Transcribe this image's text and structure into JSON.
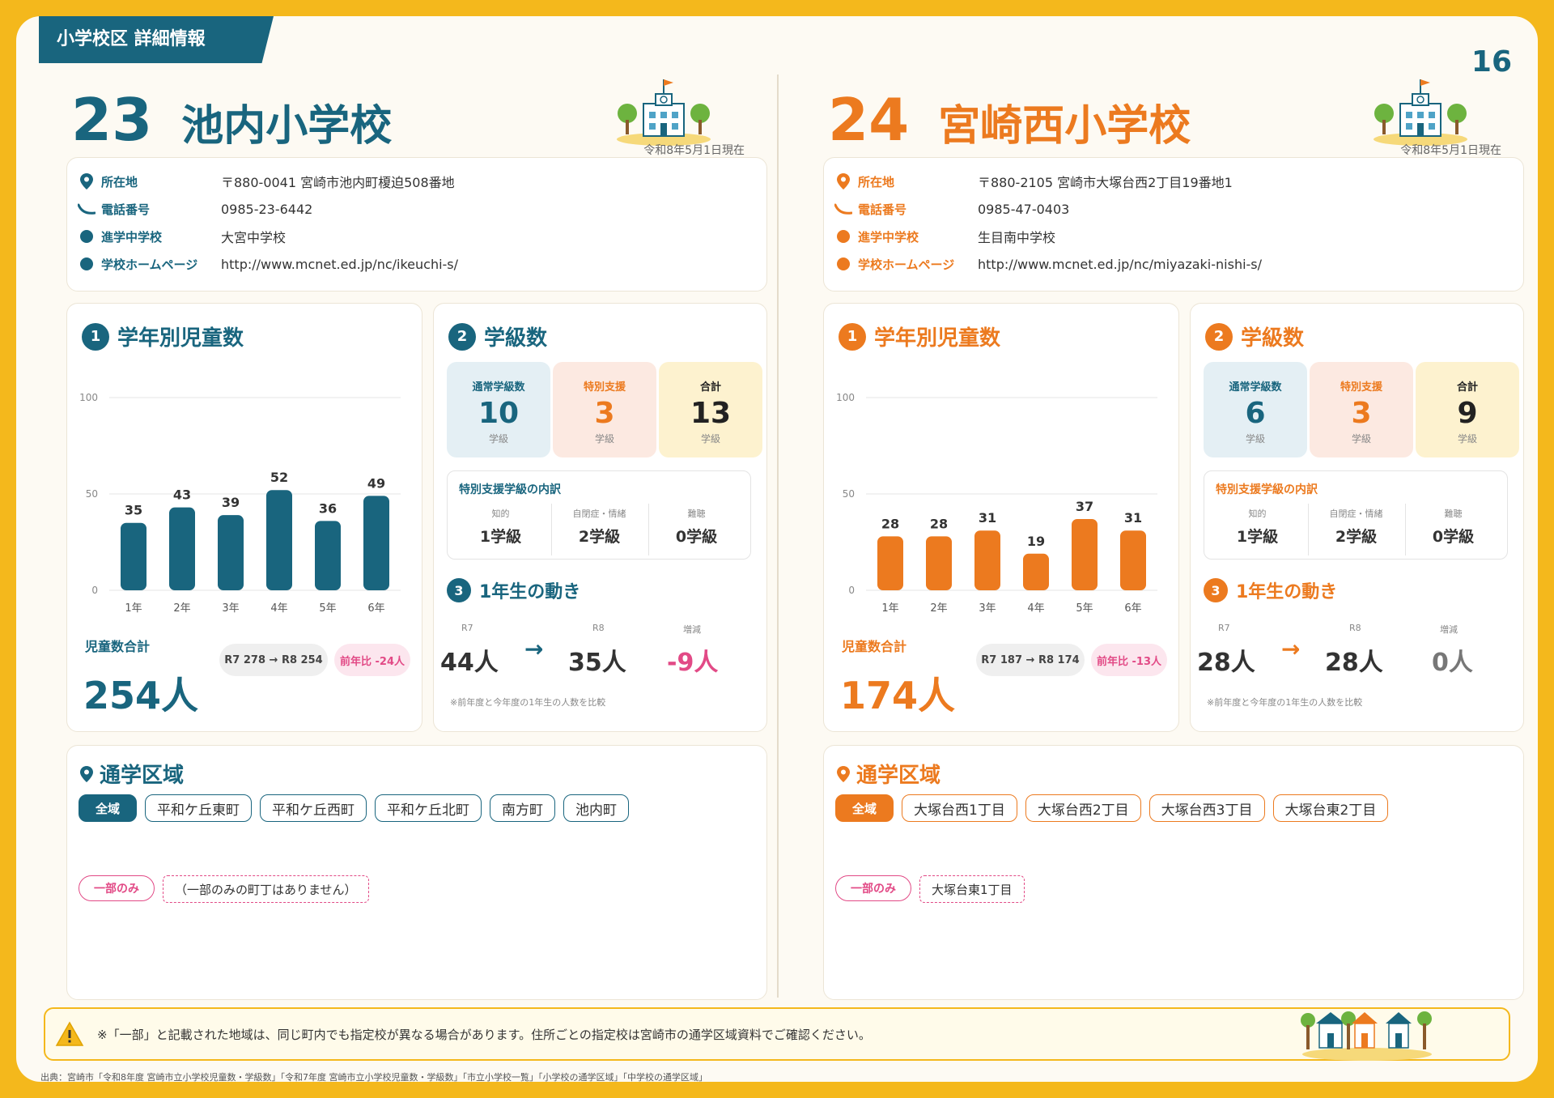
{
  "header": {
    "tab": "小学校区 詳細情報",
    "page_number": "16"
  },
  "schools": [
    {
      "number": "23",
      "name": "池内小学校",
      "as_of": "令和8年5月1日現在",
      "info": [
        {
          "label": "所在地",
          "value": "〒880-0041 宮崎市池内町榎迫508番地"
        },
        {
          "label": "電話番号",
          "value": "0985-23-6442"
        },
        {
          "label": "進学中学校",
          "value": "大宮中学校"
        },
        {
          "label": "学校ホームページ",
          "value": "http://www.mcnet.ed.jp/nc/ikeuchi-s/"
        }
      ],
      "students_title": "学年別児童数",
      "badge1": "1",
      "chart_data": {
        "type": "bar",
        "categories": [
          "1年",
          "2年",
          "3年",
          "4年",
          "5年",
          "6年"
        ],
        "values": [
          35,
          43,
          39,
          52,
          36,
          49
        ],
        "ylim": [
          0,
          100
        ],
        "yticks": [
          "0",
          "50",
          "100"
        ],
        "color": "#19657E"
      },
      "total_label": "児童数合計",
      "total": "254人",
      "compare": "R7 278 → R8 254",
      "diff": "前年比 -24人",
      "classes_title": "学級数",
      "badge2": "2",
      "classes": [
        {
          "title": "通常学級数",
          "value": "10",
          "unit": "学級"
        },
        {
          "title": "特別支援",
          "value": "3",
          "unit": "学級"
        },
        {
          "title": "合計",
          "value": "13",
          "unit": "学級"
        }
      ],
      "breakdown_title": "特別支援学級の内訳",
      "breakdown": [
        {
          "k": "知的",
          "v": "1学級"
        },
        {
          "k": "自閉症・情緒",
          "v": "2学級"
        },
        {
          "k": "難聴",
          "v": "0学級"
        }
      ],
      "movement_title": "1年生の動き",
      "badge3": "3",
      "movement": [
        {
          "k": "R7",
          "v": "44人"
        },
        {
          "k": "R8",
          "v": "35人"
        },
        {
          "k": "増減",
          "v": "-9人",
          "color": "#E24A86"
        }
      ],
      "movement_note": "※前年度と今年度の1年生の人数を比較",
      "area_title": "通学区域",
      "area_all": "全域",
      "areas": [
        "平和ケ丘東町",
        "平和ケ丘西町",
        "平和ケ丘北町",
        "南方町",
        "池内町"
      ],
      "partial_label": "一部のみ",
      "partial_value": "（一部のみの町丁はありません）",
      "accent": "#19657E"
    },
    {
      "number": "24",
      "name": "宮崎西小学校",
      "as_of": "令和8年5月1日現在",
      "info": [
        {
          "label": "所在地",
          "value": "〒880-2105 宮崎市大塚台西2丁目19番地1"
        },
        {
          "label": "電話番号",
          "value": "0985-47-0403"
        },
        {
          "label": "進学中学校",
          "value": "生目南中学校"
        },
        {
          "label": "学校ホームページ",
          "value": "http://www.mcnet.ed.jp/nc/miyazaki-nishi-s/"
        }
      ],
      "students_title": "学年別児童数",
      "badge1": "1",
      "chart_data": {
        "type": "bar",
        "categories": [
          "1年",
          "2年",
          "3年",
          "4年",
          "5年",
          "6年"
        ],
        "values": [
          28,
          28,
          31,
          19,
          37,
          31
        ],
        "ylim": [
          0,
          100
        ],
        "yticks": [
          "0",
          "50",
          "100"
        ],
        "color": "#EC7A1F"
      },
      "total_label": "児童数合計",
      "total": "174人",
      "compare": "R7 187 → R8 174",
      "diff": "前年比 -13人",
      "classes_title": "学級数",
      "badge2": "2",
      "classes": [
        {
          "title": "通常学級数",
          "value": "6",
          "unit": "学級"
        },
        {
          "title": "特別支援",
          "value": "3",
          "unit": "学級"
        },
        {
          "title": "合計",
          "value": "9",
          "unit": "学級"
        }
      ],
      "breakdown_title": "特別支援学級の内訳",
      "breakdown": [
        {
          "k": "知的",
          "v": "1学級"
        },
        {
          "k": "自閉症・情緒",
          "v": "2学級"
        },
        {
          "k": "難聴",
          "v": "0学級"
        }
      ],
      "movement_title": "1年生の動き",
      "badge3": "3",
      "movement": [
        {
          "k": "R7",
          "v": "28人"
        },
        {
          "k": "R8",
          "v": "28人"
        },
        {
          "k": "増減",
          "v": "0人",
          "color": "#777777"
        }
      ],
      "movement_note": "※前年度と今年度の1年生の人数を比較",
      "area_title": "通学区域",
      "area_all": "全域",
      "areas": [
        "大塚台西1丁目",
        "大塚台西2丁目",
        "大塚台西3丁目",
        "大塚台東2丁目"
      ],
      "partial_label": "一部のみ",
      "partial_value": "大塚台東1丁目",
      "accent": "#EC7A1F"
    }
  ],
  "note": "※「一部」と記載された地域は、同じ町内でも指定校が異なる場合があります。住所ごとの指定校は宮崎市の通学区域資料でご確認ください。",
  "source": "出典：宮崎市「令和8年度 宮崎市立小学校児童数・学級数」「令和7年度 宮崎市立小学校児童数・学級数」「市立小学校一覧」「小学校の通学区域」「中学校の通学区域」"
}
